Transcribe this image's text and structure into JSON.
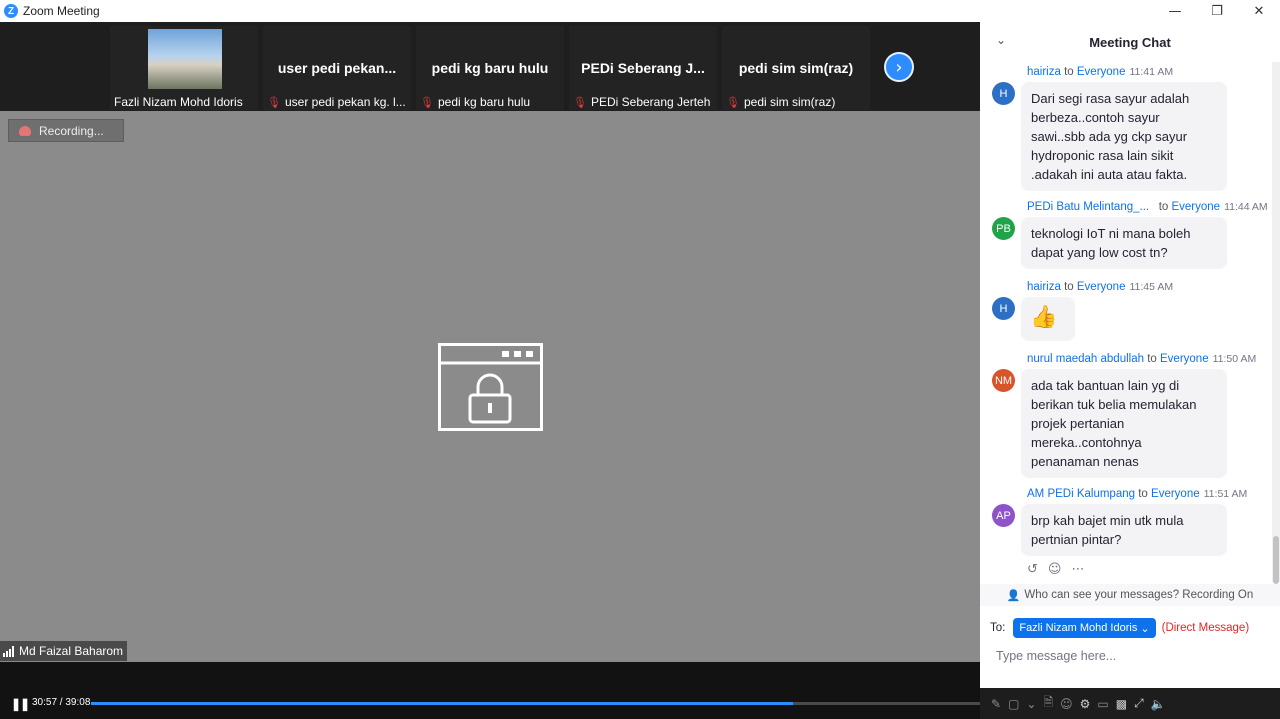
{
  "window": {
    "title": "Zoom Meeting"
  },
  "thumbnails": [
    {
      "big_name": "",
      "label": "Fazli Nizam Mohd Idoris",
      "muted": false,
      "has_photo": true
    },
    {
      "big_name": "user  pedi  pekan...",
      "label": "user pedi pekan kg. l...",
      "muted": true,
      "has_photo": false
    },
    {
      "big_name": "pedi kg baru hulu",
      "label": "pedi kg baru hulu",
      "muted": true,
      "has_photo": false
    },
    {
      "big_name": "PEDi  Seberang  J...",
      "label": "PEDi Seberang Jerteh",
      "muted": true,
      "has_photo": false
    },
    {
      "big_name": "pedi sim sim(raz)",
      "label": "pedi sim sim(raz)",
      "muted": true,
      "has_photo": false
    }
  ],
  "recording_label": "Recording...",
  "active_speaker": "Md Faizal Baharom",
  "player": {
    "time": "30:57 / 39:08",
    "progress": 0.79
  },
  "chat": {
    "title": "Meeting Chat",
    "messages": [
      {
        "initials": "H",
        "avatar_color": "#2d6fc4",
        "sender": "hairiza",
        "to": "to",
        "recipient": "Everyone",
        "time": "11:41 AM",
        "lines": [
          "Dari segi rasa sayur adalah",
          "berbeza..contoh sayur",
          "sawi..sbb ada yg ckp sayur",
          "hydroponic rasa lain sikit",
          ".adakah ini auta atau fakta."
        ]
      },
      {
        "initials": "PB",
        "avatar_color": "#22a34a",
        "sender": "PEDi Batu Melintang_...",
        "to": "to",
        "recipient": "Everyone",
        "time": "11:44 AM",
        "lines": [
          "teknologi IoT ni mana boleh",
          "dapat yang low cost tn?"
        ]
      },
      {
        "initials": "H",
        "avatar_color": "#2d6fc4",
        "sender": "hairiza",
        "to": "to",
        "recipient": "Everyone",
        "time": "11:45 AM",
        "lines": [
          "👍"
        ]
      },
      {
        "initials": "NM",
        "avatar_color": "#d9532b",
        "sender": "nurul maedah abdullah",
        "to": "to",
        "recipient": "Everyone",
        "time": "11:50 AM",
        "lines": [
          "ada tak bantuan lain yg di",
          "berikan tuk belia memulakan",
          "projek pertanian",
          "mereka..contohnya",
          "penanaman nenas"
        ]
      },
      {
        "initials": "AP",
        "avatar_color": "#8e52c9",
        "sender": "AM PEDi Kalumpang",
        "to": "to",
        "recipient": "Everyone",
        "time": "11:51 AM",
        "lines": [
          "brp kah bajet min utk mula",
          "pertnian pintar?"
        ]
      }
    ],
    "who_can_see": "Who can see your messages? Recording On",
    "to_label": "To:",
    "recipient": "Fazli Nizam Mohd Idoris",
    "direct_message": "(Direct Message)",
    "input_placeholder": "Type message here..."
  }
}
